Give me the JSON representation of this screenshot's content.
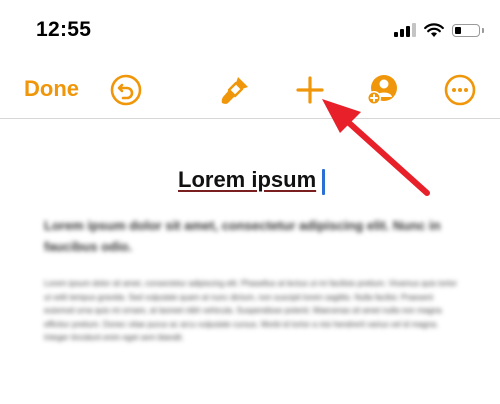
{
  "status_bar": {
    "time": "12:55",
    "icons": [
      "cellular-signal-icon",
      "wifi-icon",
      "battery-icon"
    ]
  },
  "toolbar": {
    "done_label": "Done",
    "buttons": [
      "undo-icon",
      "format-brush-icon",
      "insert-plus-icon",
      "collaborate-icon",
      "more-icon"
    ],
    "accent_color": "#f0960a"
  },
  "document": {
    "title": "Lorem ipsum",
    "paragraph_1": "Lorem ipsum dolor sit amet, consectetur adipiscing elit. Nunc in faucibus odio.",
    "paragraph_2": "Lorem ipsum dolor sit amet, consectetur adipiscing elit. Phasellus at lectus ut mi facilisis pretium. Vivamus quis tortor ut velit tempus gravida. Sed vulputate quam at nunc dictum, non suscipit lorem sagittis. Nulla facilisi. Praesent euismod urna quis mi ornare, at laoreet nibh vehicula. Suspendisse potenti. Maecenas sit amet nulla non magna efficitur pretium. Donec vitae purus ac arcu vulputate cursus. Morbi id tortor a nisi hendrerit varius vel id magna. Integer tincidunt enim eget sem blandit."
  },
  "annotation": {
    "arrow_color": "#e8202a"
  }
}
